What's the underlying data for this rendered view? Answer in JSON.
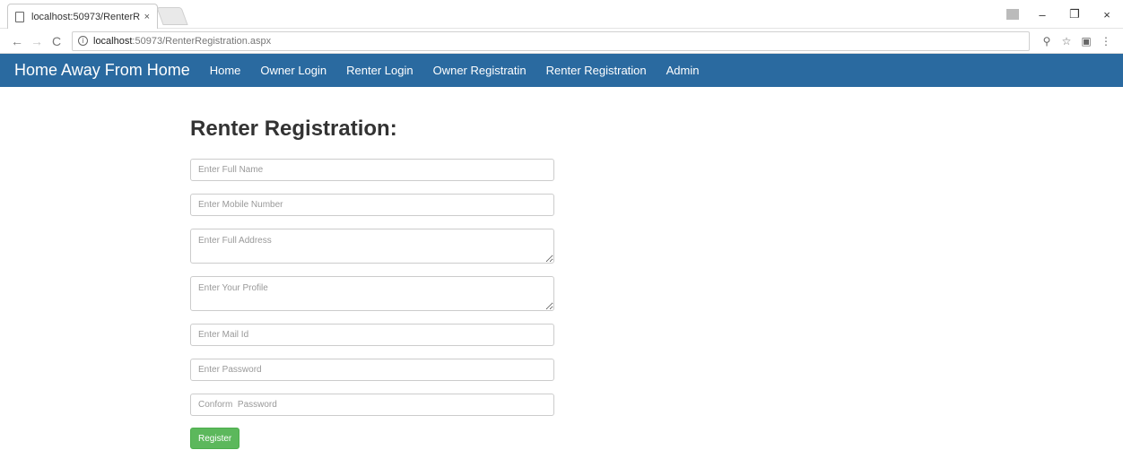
{
  "browser": {
    "tab_title": "localhost:50973/RenterR",
    "tab_close": "×",
    "url_host": "localhost",
    "url_rest": ":50973/RenterRegistration.aspx",
    "minimize": "–",
    "restore": "❐",
    "close": "×"
  },
  "site": {
    "brand": "Home Away From Home",
    "nav": [
      "Home",
      "Owner Login",
      "Renter Login",
      "Owner Registratin",
      "Renter Registration",
      "Admin"
    ]
  },
  "form": {
    "title": "Renter Registration:",
    "full_name_placeholder": "Enter Full Name",
    "mobile_placeholder": "Enter Mobile Number",
    "address_placeholder": "Enter Full Address",
    "profile_placeholder": "Enter Your Profile",
    "mail_placeholder": "Enter Mail Id",
    "password_placeholder": "Enter Password",
    "confirm_placeholder": "Conform  Password",
    "register_label": "Register"
  }
}
